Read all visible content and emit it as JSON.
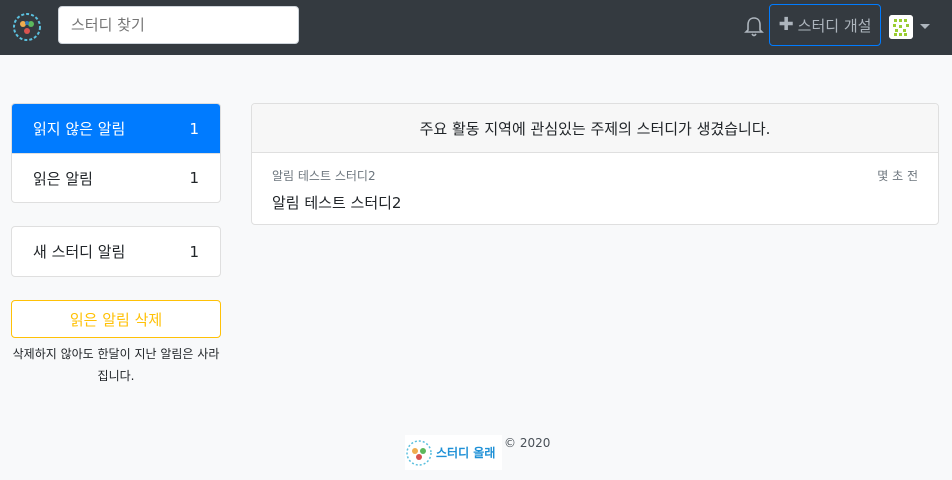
{
  "navbar": {
    "search_placeholder": "스터디 찾기",
    "create_label": "스터디 개설",
    "create_icon": "plus-icon",
    "notification_icon": "bell-icon",
    "brand_color": "#343a40"
  },
  "sidebar": {
    "items": [
      {
        "label": "읽지 않은 알림",
        "count": "1",
        "active": true
      },
      {
        "label": "읽은 알림",
        "count": "1",
        "active": false
      }
    ],
    "type_items": [
      {
        "label": "새 스터디 알림",
        "count": "1"
      }
    ],
    "delete_label": "읽은 알림 삭제",
    "delete_note": "삭제하지 않아도 한달이 지난 알림은 사라집니다."
  },
  "main": {
    "header": "주요 활동 지역에 관심있는 주제의 스터디가 생겼습니다.",
    "notifications": [
      {
        "study": "알림 테스트 스터디2",
        "time": "몇 초 전",
        "title": "알림 테스트 스터디2"
      }
    ]
  },
  "footer": {
    "logo_text": "스터디 올래",
    "copyright": "© 2020"
  },
  "colors": {
    "primary": "#007bff",
    "warning": "#ffc107",
    "background": "#f8f9fa"
  }
}
